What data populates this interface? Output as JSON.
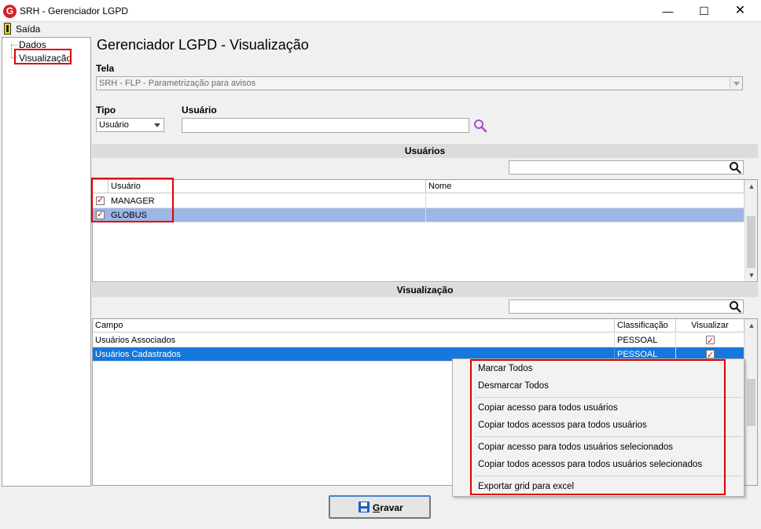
{
  "window": {
    "title": "SRH - Gerenciador LGPD",
    "app_icon": "G",
    "controls": {
      "minimize": "—",
      "maximize": "☐",
      "close": "✕"
    }
  },
  "menu": {
    "exit_label": "Saída"
  },
  "tree": {
    "items": [
      {
        "label": "Dados"
      },
      {
        "label": "Visualização"
      }
    ]
  },
  "main": {
    "title": "Gerenciador LGPD - Visualização",
    "tela_label": "Tela",
    "tela_value": "SRH - FLP - Parametrização para avisos",
    "tipo_label": "Tipo",
    "tipo_value": "Usuário",
    "usuario_label": "Usuário",
    "usuario_value": ""
  },
  "usuarios_section": {
    "header": "Usuários",
    "search_value": "",
    "columns": [
      "Usuário",
      "Nome"
    ],
    "rows": [
      {
        "checked": true,
        "usuario": "MANAGER",
        "nome": ""
      },
      {
        "checked": true,
        "usuario": "GLOBUS",
        "nome": ""
      }
    ]
  },
  "visualizacao_section": {
    "header": "Visualização",
    "search_value": "",
    "columns": [
      "Campo",
      "Classificação",
      "Visualizar"
    ],
    "rows": [
      {
        "campo": "Usuários Associados",
        "classificacao": "PESSOAL",
        "visualizar": true
      },
      {
        "campo": "Usuários Cadastrados",
        "classificacao": "PESSOAL",
        "visualizar": true
      }
    ]
  },
  "context_menu": {
    "items": [
      "Marcar Todos",
      "Desmarcar Todos",
      "Copiar acesso para todos usuários",
      "Copiar todos acessos para todos usuários",
      "Copiar acesso para todos usuários selecionados",
      "Copiar todos acessos para todos usuários selecionados",
      "Exportar grid para excel"
    ]
  },
  "footer": {
    "save_first_letter": "G",
    "save_rest": "ravar"
  },
  "colors": {
    "highlight_red": "#e00000",
    "row_selected_dark": "#1677dc",
    "row_selected_light": "#9db6e6",
    "search_icon_purple": "#a64fd1"
  }
}
